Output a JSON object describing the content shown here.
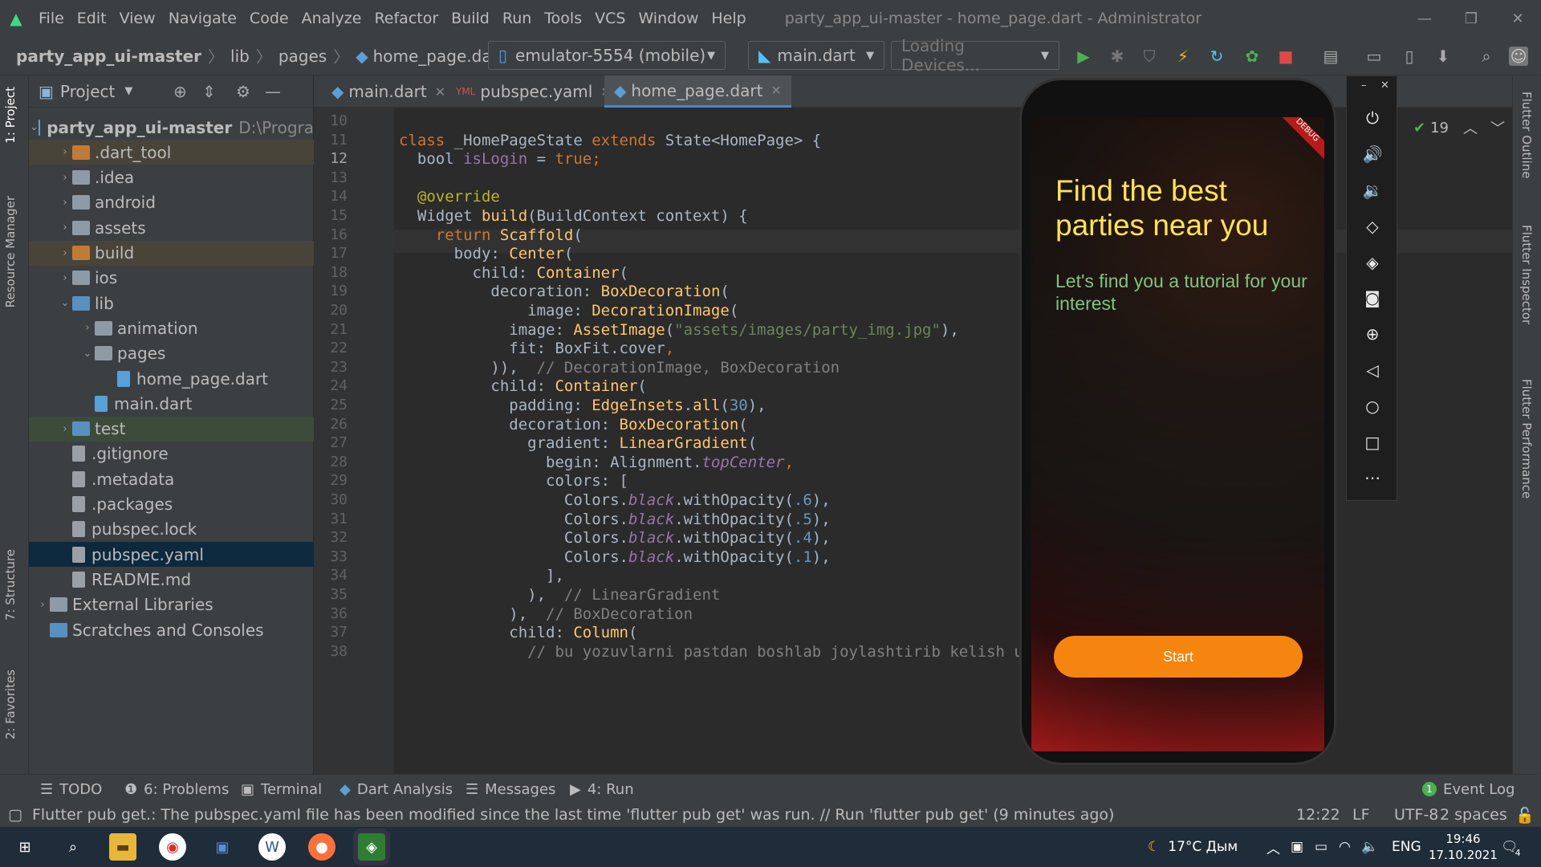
{
  "menubar": {
    "items": [
      "File",
      "Edit",
      "View",
      "Navigate",
      "Code",
      "Analyze",
      "Refactor",
      "Build",
      "Run",
      "Tools",
      "VCS",
      "Window",
      "Help"
    ],
    "title": "party_app_ui-master - home_page.dart - Administrator"
  },
  "breadcrumb": [
    "party_app_ui-master",
    "lib",
    "pages",
    "home_page.dart"
  ],
  "toolbar": {
    "device": "emulator-5554 (mobile)",
    "run_config": "main.dart",
    "devices_loading": "Loading Devices..."
  },
  "project_panel": {
    "title": "Project",
    "tree": [
      {
        "label": "party_app_ui-master",
        "extra": "D:\\Progra",
        "level": 0,
        "open": true,
        "type": "root"
      },
      {
        "label": ".dart_tool",
        "level": 1,
        "type": "folder-orange",
        "hl": "brown"
      },
      {
        "label": ".idea",
        "level": 1,
        "type": "folder"
      },
      {
        "label": "android",
        "level": 1,
        "type": "folder"
      },
      {
        "label": "assets",
        "level": 1,
        "type": "folder"
      },
      {
        "label": "build",
        "level": 1,
        "type": "folder-orange",
        "hl": "brown"
      },
      {
        "label": "ios",
        "level": 1,
        "type": "folder"
      },
      {
        "label": "lib",
        "level": 1,
        "type": "folder-blue",
        "open": true
      },
      {
        "label": "animation",
        "level": 2,
        "type": "folder"
      },
      {
        "label": "pages",
        "level": 2,
        "type": "folder",
        "open": true
      },
      {
        "label": "home_page.dart",
        "level": 3,
        "type": "dart"
      },
      {
        "label": "main.dart",
        "level": 2,
        "type": "dart"
      },
      {
        "label": "test",
        "level": 1,
        "type": "folder-green",
        "hl": "green"
      },
      {
        "label": ".gitignore",
        "level": 1,
        "type": "file"
      },
      {
        "label": ".metadata",
        "level": 1,
        "type": "file"
      },
      {
        "label": ".packages",
        "level": 1,
        "type": "file"
      },
      {
        "label": "pubspec.lock",
        "level": 1,
        "type": "file"
      },
      {
        "label": "pubspec.yaml",
        "level": 1,
        "type": "file",
        "hl": "sel"
      },
      {
        "label": "README.md",
        "level": 1,
        "type": "file"
      },
      {
        "label": "External Libraries",
        "level": 0,
        "type": "lib"
      },
      {
        "label": "Scratches and Consoles",
        "level": 0,
        "type": "scratch"
      }
    ]
  },
  "left_strip": {
    "project": "1: Project",
    "resource": "Resource Manager",
    "structure": "7: Structure",
    "favorites": "2: Favorites"
  },
  "right_strip": {
    "outline": "Flutter Outline",
    "inspector": "Flutter Inspector",
    "performance": "Flutter Performance"
  },
  "editor": {
    "tabs": [
      "main.dart",
      "pubspec.yaml",
      "home_page.dart"
    ],
    "active_tab": "home_page.dart",
    "problems_count": "19",
    "line_start": 10,
    "lines": [
      [],
      [
        [
          "kw",
          "class "
        ],
        [
          "",
          "_HomePageState "
        ],
        [
          "kw",
          "extends "
        ],
        [
          "",
          "State<HomePage> {"
        ]
      ],
      [
        [
          "",
          "  bool "
        ],
        [
          "fld",
          "isLogin "
        ],
        [
          "",
          "= "
        ],
        [
          "kw",
          "true"
        ],
        [
          "kw",
          ";"
        ]
      ],
      [],
      [
        [
          "ann",
          "  @override"
        ]
      ],
      [
        [
          "",
          "  Widget "
        ],
        [
          "fn",
          "build"
        ],
        [
          "",
          "(BuildContext context) {"
        ]
      ],
      [
        [
          "kw",
          "    return "
        ],
        [
          "cls",
          "Scaffold"
        ],
        [
          "",
          "("
        ]
      ],
      [
        [
          "",
          "      body: "
        ],
        [
          "cls",
          "Center"
        ],
        [
          "",
          "("
        ]
      ],
      [
        [
          "",
          "        child: "
        ],
        [
          "cls",
          "Container"
        ],
        [
          "",
          "("
        ]
      ],
      [
        [
          "",
          "          decoration: "
        ],
        [
          "cls",
          "BoxDecoration"
        ],
        [
          "",
          "("
        ]
      ],
      [
        [
          "",
          "              image: "
        ],
        [
          "cls",
          "DecorationImage"
        ],
        [
          "",
          "("
        ]
      ],
      [
        [
          "",
          "            image: "
        ],
        [
          "cls",
          "AssetImage"
        ],
        [
          "",
          "("
        ],
        [
          "str",
          "\"assets/images/party_img.jpg\""
        ],
        [
          "",
          "),"
        ]
      ],
      [
        [
          "",
          "            fit: BoxFit."
        ],
        [
          "",
          "cover"
        ],
        [
          "kw",
          ","
        ]
      ],
      [
        [
          "",
          "          )),  "
        ],
        [
          "cm",
          "// DecorationImage, BoxDecoration"
        ]
      ],
      [
        [
          "",
          "          child: "
        ],
        [
          "cls",
          "Container"
        ],
        [
          "",
          "("
        ]
      ],
      [
        [
          "",
          "            padding: "
        ],
        [
          "cls",
          "EdgeInsets"
        ],
        [
          "",
          "."
        ],
        [
          "fn",
          "all"
        ],
        [
          "",
          "("
        ],
        [
          "num",
          "30"
        ],
        [
          "",
          "),"
        ]
      ],
      [
        [
          "",
          "            decoration: "
        ],
        [
          "cls",
          "BoxDecoration"
        ],
        [
          "",
          "("
        ]
      ],
      [
        [
          "",
          "              gradient: "
        ],
        [
          "cls",
          "LinearGradient"
        ],
        [
          "",
          "("
        ]
      ],
      [
        [
          "",
          "                begin: Alignment."
        ],
        [
          "it",
          "topCenter"
        ],
        [
          "kw",
          ","
        ]
      ],
      [
        [
          "",
          "                colors: ["
        ]
      ],
      [
        [
          "",
          "                  Colors."
        ],
        [
          "it",
          "black"
        ],
        [
          "",
          ".withOpacity("
        ],
        [
          "num",
          ".6"
        ],
        [
          "",
          "),"
        ]
      ],
      [
        [
          "",
          "                  Colors."
        ],
        [
          "it",
          "black"
        ],
        [
          "",
          ".withOpacity("
        ],
        [
          "num",
          ".5"
        ],
        [
          "",
          "),"
        ]
      ],
      [
        [
          "",
          "                  Colors."
        ],
        [
          "it",
          "black"
        ],
        [
          "",
          ".withOpacity("
        ],
        [
          "num",
          ".4"
        ],
        [
          "",
          "),"
        ]
      ],
      [
        [
          "",
          "                  Colors."
        ],
        [
          "it",
          "black"
        ],
        [
          "",
          ".withOpacity("
        ],
        [
          "num",
          ".1"
        ],
        [
          "",
          "),"
        ]
      ],
      [
        [
          "",
          "                ],"
        ]
      ],
      [
        [
          "",
          "              ),  "
        ],
        [
          "cm",
          "// LinearGradient"
        ]
      ],
      [
        [
          "",
          "            ),  "
        ],
        [
          "cm",
          "// BoxDecoration"
        ]
      ],
      [
        [
          "",
          "            child: "
        ],
        [
          "cls",
          "Column"
        ],
        [
          "",
          "("
        ]
      ],
      [
        [
          "cm",
          "              // bu yozuvlarni pastdan boshlab joylashtirib kelish uchun"
        ]
      ]
    ]
  },
  "phone": {
    "headline": "Find the best parties near you",
    "subtitle": "Let's find you a tutorial for your interest",
    "start_button": "Start",
    "debug_banner": "DEBUG"
  },
  "bottom_tabs": [
    "TODO",
    "6: Problems",
    "Terminal",
    "Dart Analysis",
    "Messages",
    "4: Run",
    "Event Log"
  ],
  "status": {
    "message": "Flutter pub get.: The pubspec.yaml file has been modified since the last time 'flutter pub get' was run. // Run 'flutter pub get' (9 minutes ago)",
    "position": "12:22",
    "line_sep": "LF",
    "encoding": "UTF-8",
    "indent": "2 spaces"
  },
  "taskbar": {
    "weather": "17°C Дым",
    "lang": "ENG",
    "time": "19:46",
    "date": "17.10.2021",
    "notifications": "4"
  }
}
